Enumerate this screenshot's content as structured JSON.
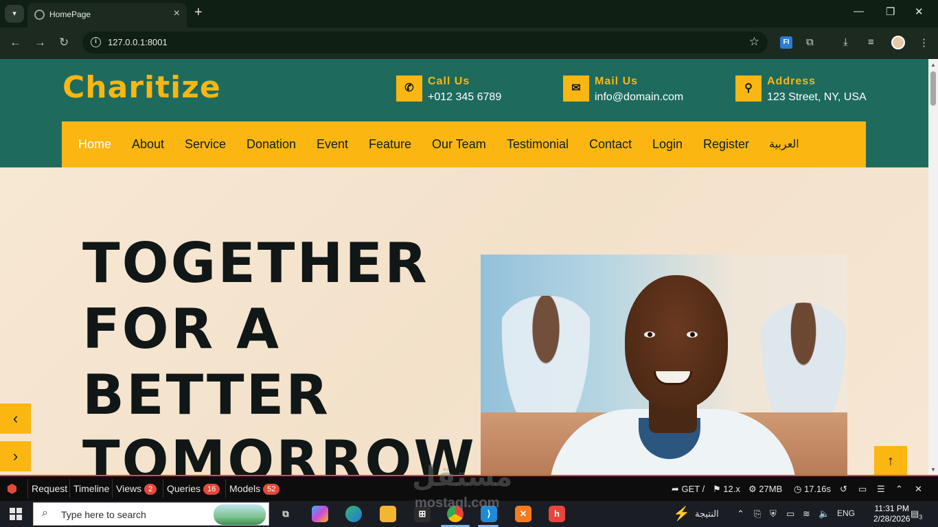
{
  "browser": {
    "tab_title": "HomePage",
    "url": "127.0.0.1:8001",
    "ext_fi_label": "FI"
  },
  "site": {
    "logo": "Charitize",
    "contacts": [
      {
        "label": "Call Us",
        "value": "+012 345 6789",
        "icon": "phone-icon"
      },
      {
        "label": "Mail Us",
        "value": "info@domain.com",
        "icon": "envelope-icon"
      },
      {
        "label": "Address",
        "value": "123 Street, NY, USA",
        "icon": "map-pin-icon"
      }
    ],
    "nav": [
      "Home",
      "About",
      "Service",
      "Donation",
      "Event",
      "Feature",
      "Our Team",
      "Testimonial",
      "Contact",
      "Login",
      "Register",
      "العربية"
    ],
    "active_nav": "Home",
    "hero_lines": [
      "TOGETHER",
      "FOR A",
      "BETTER",
      "TOMORROW"
    ],
    "colors": {
      "primary": "#1e6b5e",
      "accent": "#fbb612",
      "hero_bg": "#f6e6d2"
    }
  },
  "debugbar": {
    "items": [
      {
        "label": "Request"
      },
      {
        "label": "Timeline"
      },
      {
        "label": "Views",
        "badge": "2"
      },
      {
        "label": "Queries",
        "badge": "16"
      },
      {
        "label": "Models",
        "badge": "52"
      }
    ],
    "method": "GET /",
    "version": "12.x",
    "memory": "27MB",
    "time": "17.16s"
  },
  "taskbar": {
    "search_placeholder": "Type here to search",
    "tray_app_label": "النتيجة",
    "language": "ENG",
    "time": "11:31 PM",
    "date": "2/28/2026",
    "notifications": "3"
  },
  "watermark": {
    "text": "مستقل",
    "sub": "mostaql.com"
  }
}
